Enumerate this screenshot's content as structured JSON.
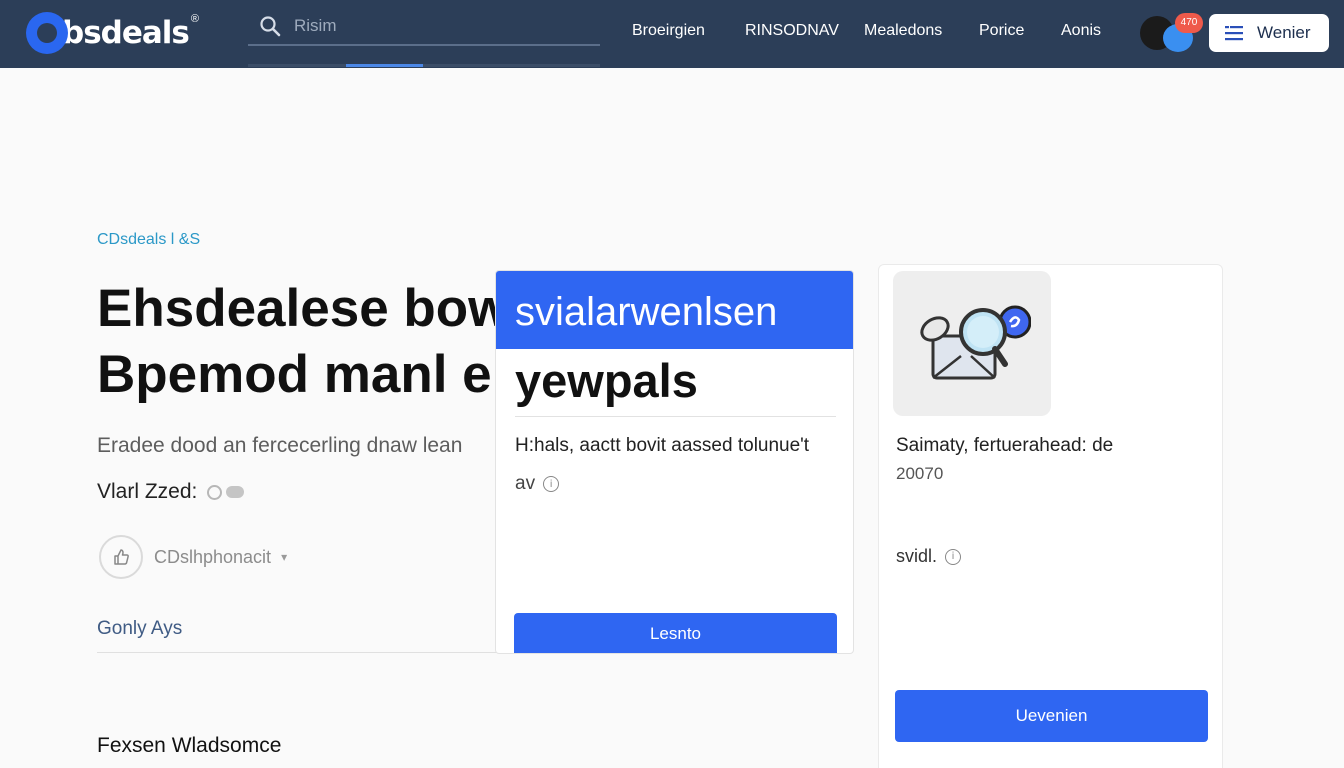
{
  "header": {
    "logo_text": "bsdeals",
    "logo_reg": "®",
    "search": {
      "placeholder": "Risim"
    },
    "search_progress": 0.22,
    "nav": [
      "Broeirgien",
      "RINSODNAV",
      "Mealedons",
      "Porice",
      "Aonis"
    ],
    "notification_badge": "470",
    "cta_label": "Wenier"
  },
  "hero": {
    "breadcrumb": "CDsdeals l &S",
    "title_line1": "Ehsdealese bow",
    "title_line2": "Bpemod manl e",
    "description": "Eradee dood an fercecerling dnaw lean",
    "author": "Vlarl Zzed:",
    "like_label": "CDslhphonacit",
    "section_link": "Gonly Ays",
    "footer_heading": "Fexsen Wladsomce"
  },
  "card_center": {
    "banner": "svialarwenlsen",
    "title": "yewpals",
    "body1": "H:hals, aactt bovit aassed tolunue't",
    "body2": "av",
    "button": "Lesnto"
  },
  "card_right": {
    "body1": "Saimaty, fertuerahead: de",
    "body2": "20070",
    "body3": "svidl.",
    "button": "Uevenien"
  },
  "colors": {
    "nav_bg": "#2c3e58",
    "accent": "#2f66f2",
    "badge": "#ef5a4b",
    "breadcrumb": "#2b98c7"
  },
  "icons": [
    "search-icon",
    "menu-icon",
    "like-icon",
    "info-icon",
    "magnifier-envelope-icon"
  ]
}
